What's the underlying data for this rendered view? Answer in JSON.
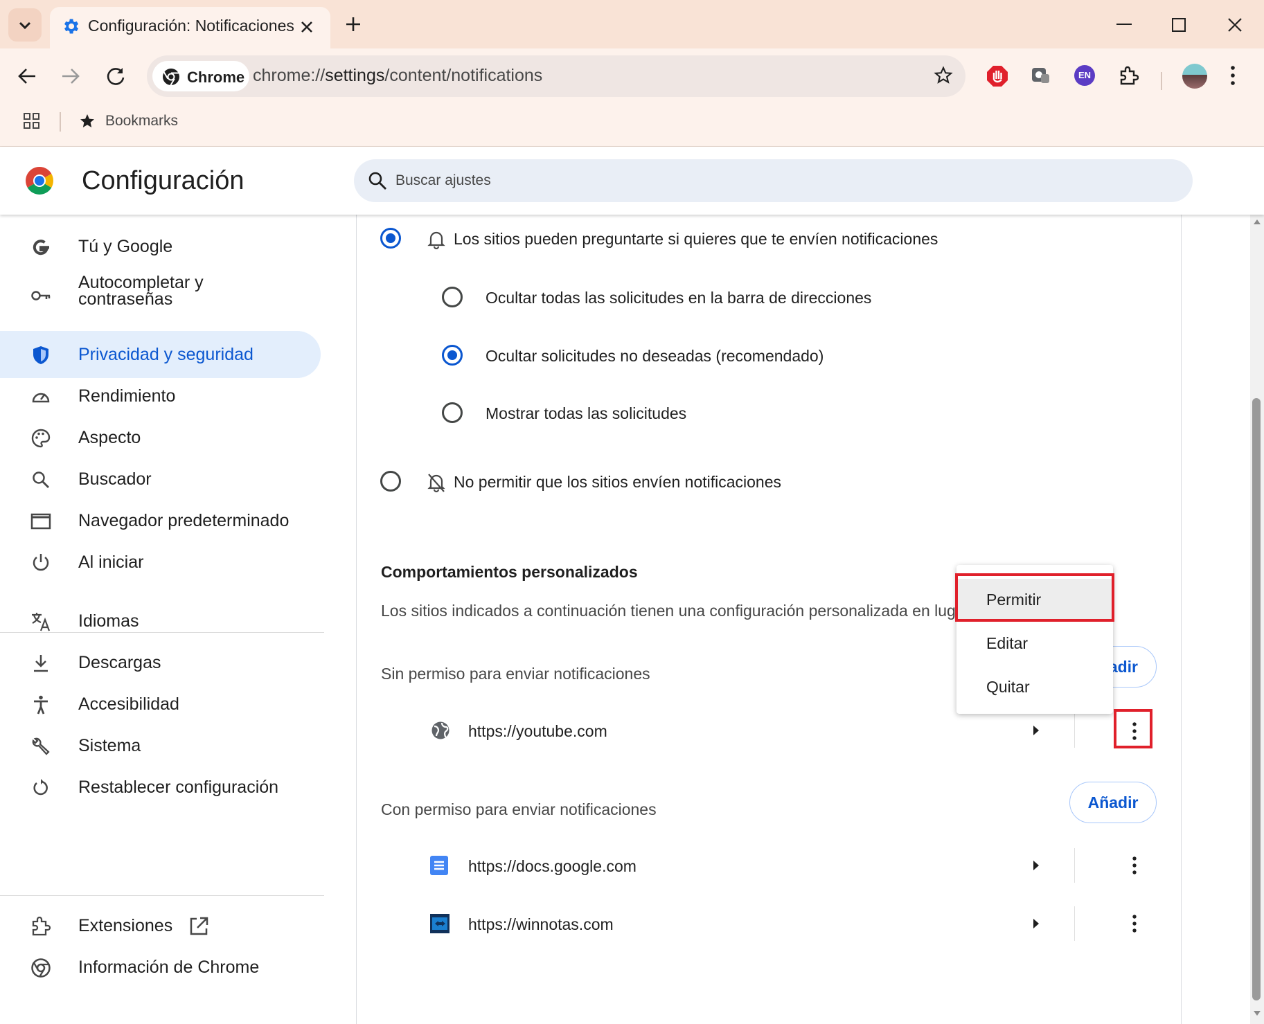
{
  "tab": {
    "title": "Configuración: Notificaciones"
  },
  "toolbar": {
    "chip_label": "Chrome",
    "url_scheme": "chrome://",
    "url_host": "settings",
    "url_path": "/content/notifications",
    "extension_badge": "EN",
    "bookmarks_label": "Bookmarks"
  },
  "settings": {
    "title": "Configuración",
    "search_placeholder": "Buscar ajustes"
  },
  "sidebar": {
    "items": [
      {
        "label": "Tú y Google",
        "icon": "google-g-icon"
      },
      {
        "label": "Autocompletar y contraseñas",
        "icon": "key-icon"
      },
      {
        "label": "Privacidad y seguridad",
        "icon": "shield-icon"
      },
      {
        "label": "Rendimiento",
        "icon": "speedometer-icon"
      },
      {
        "label": "Aspecto",
        "icon": "palette-icon"
      },
      {
        "label": "Buscador",
        "icon": "search-icon"
      },
      {
        "label": "Navegador predeterminado",
        "icon": "browser-window-icon"
      },
      {
        "label": "Al iniciar",
        "icon": "power-icon"
      },
      {
        "label": "Idiomas",
        "icon": "translate-icon"
      },
      {
        "label": "Descargas",
        "icon": "download-icon"
      },
      {
        "label": "Accesibilidad",
        "icon": "accessibility-icon"
      },
      {
        "label": "Sistema",
        "icon": "wrench-icon"
      },
      {
        "label": "Restablecer configuración",
        "icon": "reset-icon"
      },
      {
        "label": "Extensiones",
        "icon": "puzzle-icon"
      },
      {
        "label": "Información de Chrome",
        "icon": "chrome-icon"
      }
    ]
  },
  "notifications": {
    "option_ask": "Los sitios pueden preguntarte si quieres que te envíen notificaciones",
    "sub_options": [
      {
        "label": "Ocultar todas las solicitudes en la barra de direcciones",
        "selected": false
      },
      {
        "label": "Ocultar solicitudes no deseadas (recomendado)",
        "selected": true
      },
      {
        "label": "Mostrar todas las solicitudes",
        "selected": false
      }
    ],
    "option_block": "No permitir que los sitios envíen notificaciones",
    "custom_header": "Comportamientos personalizados",
    "custom_desc": "Los sitios indicados a continuación tienen una configuración personalizada en luga",
    "blocked_header": "Sin permiso para enviar notificaciones",
    "blocked_add_partial": "adir",
    "blocked_sites": [
      "https://youtube.com"
    ],
    "allowed_header": "Con permiso para enviar notificaciones",
    "allowed_add": "Añadir",
    "allowed_sites": [
      "https://docs.google.com",
      "https://winnotas.com"
    ]
  },
  "menu": {
    "items": [
      "Permitir",
      "Editar",
      "Quitar"
    ],
    "highlighted": "Permitir"
  },
  "colors": {
    "accent": "#0b57d0",
    "highlight_box": "#e0202b",
    "tabstrip": "#f9e3d6",
    "toolbar": "#fdf2ec"
  }
}
